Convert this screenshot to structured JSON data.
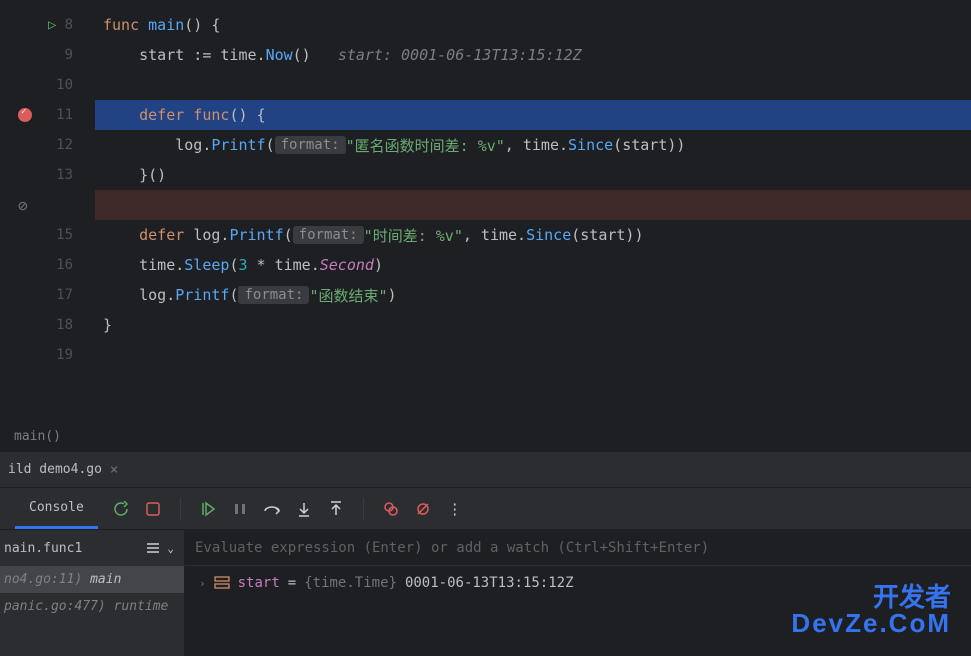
{
  "gutter": {
    "lines": [
      "8",
      "9",
      "10",
      "11",
      "12",
      "13",
      "",
      "15",
      "16",
      "17",
      "18",
      "19"
    ]
  },
  "code": {
    "line8": {
      "kw": "func ",
      "fn": "main",
      "rest": "() {"
    },
    "line9": {
      "indent": "    ",
      "var": "start",
      "op": " := ",
      "pkg": "time",
      "dot": ".",
      "call": "Now",
      "rest": "()",
      "hint_label": "start:",
      "hint_val": " 0001-06-13T13:15:12Z"
    },
    "line11": {
      "indent": "    ",
      "kw": "defer func",
      "rest": "() {"
    },
    "line12": {
      "indent": "        ",
      "pkg": "log",
      "dot": ".",
      "fn": "Printf",
      "open": "(",
      "param": "format:",
      "str": "\"匿名函数时间差: %v\"",
      "mid": ", ",
      "pkg2": "time",
      "dot2": ".",
      "fn2": "Since",
      "open2": "(",
      "arg": "start",
      "close": "))"
    },
    "line13": {
      "indent": "    ",
      "rest": "}()"
    },
    "line15": {
      "indent": "    ",
      "kw": "defer ",
      "pkg": "log",
      "dot": ".",
      "fn": "Printf",
      "open": "(",
      "param": "format:",
      "str": "\"时间差: %v\"",
      "mid": ", ",
      "pkg2": "time",
      "dot2": ".",
      "fn2": "Since",
      "open2": "(",
      "arg": "start",
      "close": "))"
    },
    "line16": {
      "indent": "    ",
      "pkg": "time",
      "dot": ".",
      "fn": "Sleep",
      "open": "(",
      "num": "3",
      "op": " * ",
      "pkg2": "time",
      "dot2": ".",
      "ident": "Second",
      "close": ")"
    },
    "line17": {
      "indent": "    ",
      "pkg": "log",
      "dot": ".",
      "fn": "Printf",
      "open": "(",
      "param": "format:",
      "str": "\"函数结束\"",
      "close": ")"
    },
    "line18": {
      "rest": "}"
    }
  },
  "breadcrumb": {
    "text": "main()"
  },
  "tabs": {
    "active": "ild demo4.go"
  },
  "debug": {
    "console_label": "Console",
    "frames": {
      "current": "nain.func1",
      "items": [
        {
          "loc": "no4.go:11)",
          "fn": "main"
        },
        {
          "loc": "panic.go:477)",
          "fn": "runtime"
        }
      ]
    },
    "eval_placeholder": "Evaluate expression (Enter) or add a watch (Ctrl+Shift+Enter)",
    "vars": [
      {
        "name": "start",
        "equals": " = ",
        "type": "{time.Time}",
        "value": " 0001-06-13T13:15:12Z"
      }
    ]
  },
  "watermark": {
    "line1": "开发者",
    "line2": "DevZe.CoM"
  }
}
